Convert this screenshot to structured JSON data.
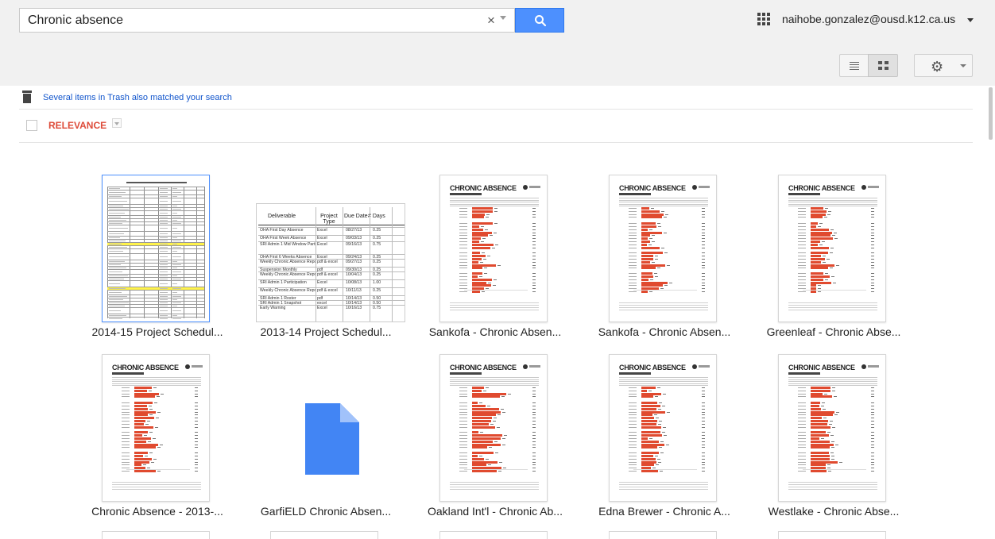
{
  "search": {
    "query": "Chronic absence",
    "clear_symbol": "×"
  },
  "header": {
    "account_email": "naihobe.gonzalez@ousd.k12.ca.us"
  },
  "toolbar": {
    "view_list_icon": "list-view-icon",
    "view_grid_icon": "grid-view-icon",
    "settings_icon": "gear-icon"
  },
  "notice": {
    "trash_text": "Several items in Trash also matched your search"
  },
  "sort": {
    "label": "RELEVANCE"
  },
  "files": [
    {
      "title": "2014-15 Project Schedul...",
      "kind": "spreadsheet-1"
    },
    {
      "title": "2013-14 Project Schedul...",
      "kind": "spreadsheet-2"
    },
    {
      "title": "Sankofa - Chronic Absen...",
      "kind": "report"
    },
    {
      "title": "Sankofa - Chronic Absen...",
      "kind": "report"
    },
    {
      "title": "Greenleaf - Chronic Abse...",
      "kind": "report"
    },
    {
      "title": "Chronic Absence - 2013-...",
      "kind": "report"
    },
    {
      "title": "GarfiELD Chronic Absen...",
      "kind": "blank"
    },
    {
      "title": "Oakland Int'l - Chronic Ab...",
      "kind": "report"
    },
    {
      "title": "Edna Brewer - Chronic A...",
      "kind": "report"
    },
    {
      "title": "Westlake - Chronic Abse...",
      "kind": "report"
    }
  ],
  "thumbnails": {
    "report_title": "CHRONIC ABSENCE",
    "sheet2": {
      "headers": [
        "Deliverable",
        "Project Type",
        "Due Date",
        "# Days"
      ],
      "rows": [
        [
          "OHA First Day Absence",
          "Excel",
          "08/27/13",
          "0.25"
        ],
        [
          "OHA First Week Absence",
          "Excel",
          "09/03/13",
          "0.25"
        ],
        [
          "SRI Admin 1 Mid Window Participation",
          "Excel",
          "09/16/13",
          "0.75"
        ],
        [
          "OHA First 6 Weeks Absence",
          "Excel",
          "09/24/13",
          "0.25"
        ],
        [
          "Weekly Chronic Absence Report & List",
          "pdf & excel",
          "09/27/13",
          "0.25"
        ],
        [
          "Suspension Monthly",
          "pdf",
          "09/30/13",
          "0.25"
        ],
        [
          "Weekly Chronic Absence Report & List",
          "pdf & excel",
          "10/04/13",
          "0.25"
        ],
        [
          "SRI Admin 1 Participation",
          "Excel",
          "10/08/13",
          "1.00"
        ],
        [
          "Weekly Chronic Absence Report & List",
          "pdf & excel",
          "10/11/13",
          "0.25"
        ],
        [
          "SRI Admin 1 Roster",
          "pdf",
          "10/14/13",
          "0.50"
        ],
        [
          "SRI Admin 1 Snapshot",
          "excel",
          "10/14/13",
          "0.50"
        ],
        [
          "Early Warning",
          "Excel",
          "10/16/13",
          "0.75"
        ]
      ]
    }
  },
  "colors": {
    "search_button": "#4d90fe",
    "relevance": "#dd4b39",
    "link": "#1155cc",
    "report_bar": "#e04a2f",
    "doc_blue": "#4285f4"
  }
}
